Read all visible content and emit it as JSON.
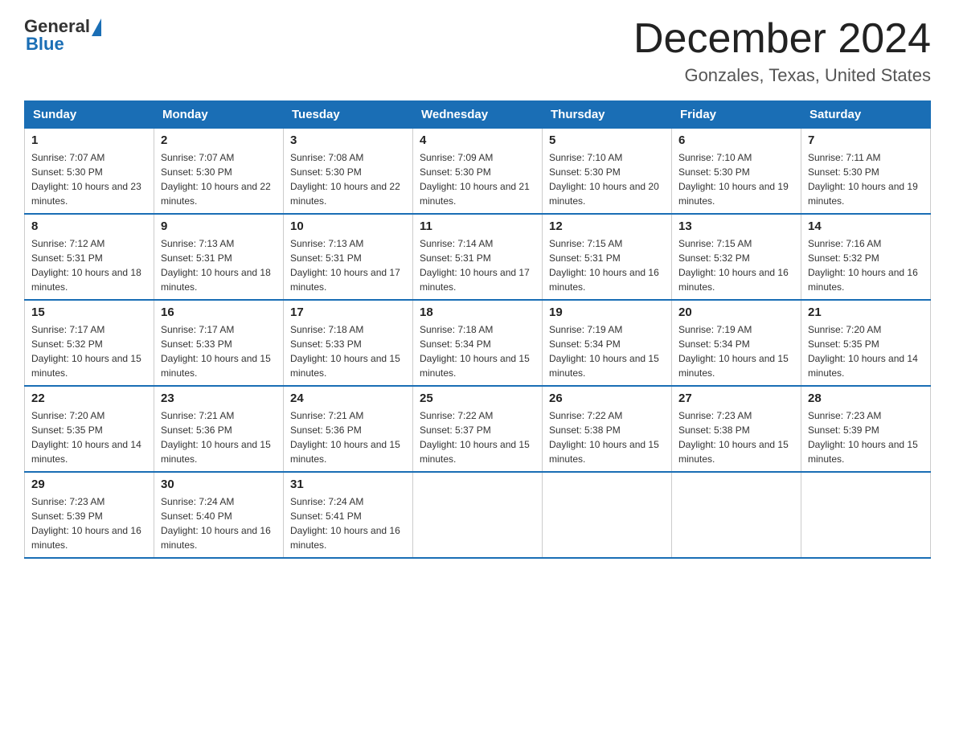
{
  "logo": {
    "general": "General",
    "blue": "Blue"
  },
  "title": "December 2024",
  "subtitle": "Gonzales, Texas, United States",
  "days_of_week": [
    "Sunday",
    "Monday",
    "Tuesday",
    "Wednesday",
    "Thursday",
    "Friday",
    "Saturday"
  ],
  "weeks": [
    [
      {
        "day": 1,
        "sunrise": "7:07 AM",
        "sunset": "5:30 PM",
        "daylight": "10 hours and 23 minutes."
      },
      {
        "day": 2,
        "sunrise": "7:07 AM",
        "sunset": "5:30 PM",
        "daylight": "10 hours and 22 minutes."
      },
      {
        "day": 3,
        "sunrise": "7:08 AM",
        "sunset": "5:30 PM",
        "daylight": "10 hours and 22 minutes."
      },
      {
        "day": 4,
        "sunrise": "7:09 AM",
        "sunset": "5:30 PM",
        "daylight": "10 hours and 21 minutes."
      },
      {
        "day": 5,
        "sunrise": "7:10 AM",
        "sunset": "5:30 PM",
        "daylight": "10 hours and 20 minutes."
      },
      {
        "day": 6,
        "sunrise": "7:10 AM",
        "sunset": "5:30 PM",
        "daylight": "10 hours and 19 minutes."
      },
      {
        "day": 7,
        "sunrise": "7:11 AM",
        "sunset": "5:30 PM",
        "daylight": "10 hours and 19 minutes."
      }
    ],
    [
      {
        "day": 8,
        "sunrise": "7:12 AM",
        "sunset": "5:31 PM",
        "daylight": "10 hours and 18 minutes."
      },
      {
        "day": 9,
        "sunrise": "7:13 AM",
        "sunset": "5:31 PM",
        "daylight": "10 hours and 18 minutes."
      },
      {
        "day": 10,
        "sunrise": "7:13 AM",
        "sunset": "5:31 PM",
        "daylight": "10 hours and 17 minutes."
      },
      {
        "day": 11,
        "sunrise": "7:14 AM",
        "sunset": "5:31 PM",
        "daylight": "10 hours and 17 minutes."
      },
      {
        "day": 12,
        "sunrise": "7:15 AM",
        "sunset": "5:31 PM",
        "daylight": "10 hours and 16 minutes."
      },
      {
        "day": 13,
        "sunrise": "7:15 AM",
        "sunset": "5:32 PM",
        "daylight": "10 hours and 16 minutes."
      },
      {
        "day": 14,
        "sunrise": "7:16 AM",
        "sunset": "5:32 PM",
        "daylight": "10 hours and 16 minutes."
      }
    ],
    [
      {
        "day": 15,
        "sunrise": "7:17 AM",
        "sunset": "5:32 PM",
        "daylight": "10 hours and 15 minutes."
      },
      {
        "day": 16,
        "sunrise": "7:17 AM",
        "sunset": "5:33 PM",
        "daylight": "10 hours and 15 minutes."
      },
      {
        "day": 17,
        "sunrise": "7:18 AM",
        "sunset": "5:33 PM",
        "daylight": "10 hours and 15 minutes."
      },
      {
        "day": 18,
        "sunrise": "7:18 AM",
        "sunset": "5:34 PM",
        "daylight": "10 hours and 15 minutes."
      },
      {
        "day": 19,
        "sunrise": "7:19 AM",
        "sunset": "5:34 PM",
        "daylight": "10 hours and 15 minutes."
      },
      {
        "day": 20,
        "sunrise": "7:19 AM",
        "sunset": "5:34 PM",
        "daylight": "10 hours and 15 minutes."
      },
      {
        "day": 21,
        "sunrise": "7:20 AM",
        "sunset": "5:35 PM",
        "daylight": "10 hours and 14 minutes."
      }
    ],
    [
      {
        "day": 22,
        "sunrise": "7:20 AM",
        "sunset": "5:35 PM",
        "daylight": "10 hours and 14 minutes."
      },
      {
        "day": 23,
        "sunrise": "7:21 AM",
        "sunset": "5:36 PM",
        "daylight": "10 hours and 15 minutes."
      },
      {
        "day": 24,
        "sunrise": "7:21 AM",
        "sunset": "5:36 PM",
        "daylight": "10 hours and 15 minutes."
      },
      {
        "day": 25,
        "sunrise": "7:22 AM",
        "sunset": "5:37 PM",
        "daylight": "10 hours and 15 minutes."
      },
      {
        "day": 26,
        "sunrise": "7:22 AM",
        "sunset": "5:38 PM",
        "daylight": "10 hours and 15 minutes."
      },
      {
        "day": 27,
        "sunrise": "7:23 AM",
        "sunset": "5:38 PM",
        "daylight": "10 hours and 15 minutes."
      },
      {
        "day": 28,
        "sunrise": "7:23 AM",
        "sunset": "5:39 PM",
        "daylight": "10 hours and 15 minutes."
      }
    ],
    [
      {
        "day": 29,
        "sunrise": "7:23 AM",
        "sunset": "5:39 PM",
        "daylight": "10 hours and 16 minutes."
      },
      {
        "day": 30,
        "sunrise": "7:24 AM",
        "sunset": "5:40 PM",
        "daylight": "10 hours and 16 minutes."
      },
      {
        "day": 31,
        "sunrise": "7:24 AM",
        "sunset": "5:41 PM",
        "daylight": "10 hours and 16 minutes."
      },
      null,
      null,
      null,
      null
    ]
  ]
}
